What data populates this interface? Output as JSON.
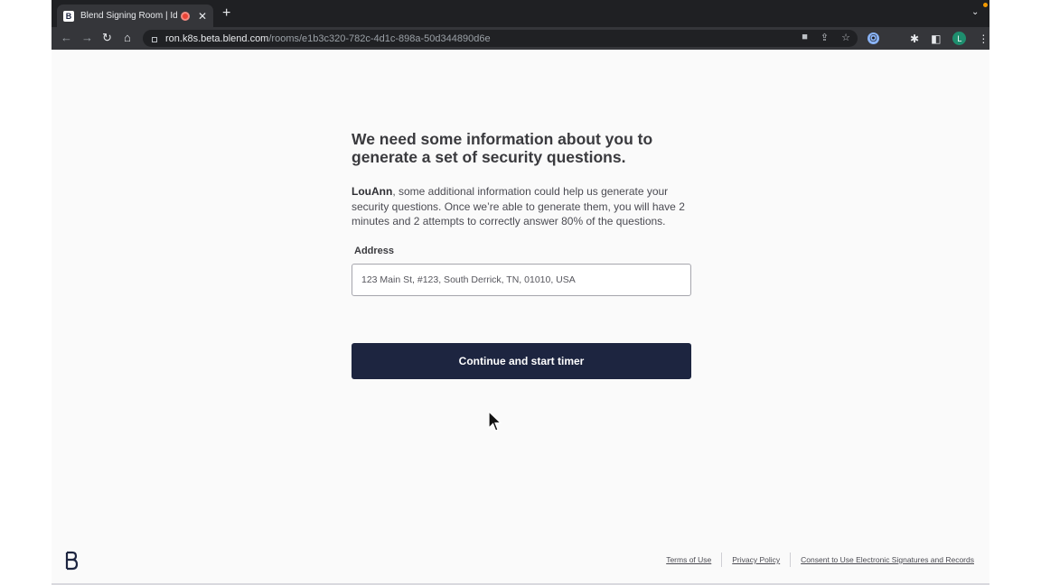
{
  "browser": {
    "tab_title": "Blend Signing Room | Identity",
    "new_tab_glyph": "+",
    "close_glyph": "✕",
    "url_host": "ron.k8s.beta.blend.com",
    "url_path": "/rooms/e1b3c320-782c-4d1c-898a-50d344890d6e",
    "profile_initial": "L",
    "favicon_letter": "B"
  },
  "page": {
    "heading": "We need some information about you to generate a set of security questions.",
    "intro_name": "LouAnn",
    "intro_text": ", some additional information could help us generate your security questions. Once we’re able to generate them, you will have 2 minutes and 2 attempts to correctly answer 80% of the questions.",
    "address_label": "Address",
    "address_value": "123 Main St, #123, South Derrick, TN, 01010, USA",
    "continue_label": "Continue and start timer"
  },
  "footer": {
    "terms": "Terms of Use",
    "privacy": "Privacy Policy",
    "consent": "Consent to Use Electronic Signatures and Records"
  },
  "colors": {
    "primary_button": "#1d2540",
    "page_background": "#fafafa",
    "browser_frame": "#35363a"
  },
  "icons": [
    "back-icon",
    "forward-icon",
    "reload-icon",
    "home-icon",
    "lock-icon",
    "camera-icon",
    "share-icon",
    "star-icon",
    "password-icon",
    "extensions-icon",
    "sidepanel-icon",
    "menu-icon",
    "blend-logo",
    "mouse-cursor"
  ]
}
